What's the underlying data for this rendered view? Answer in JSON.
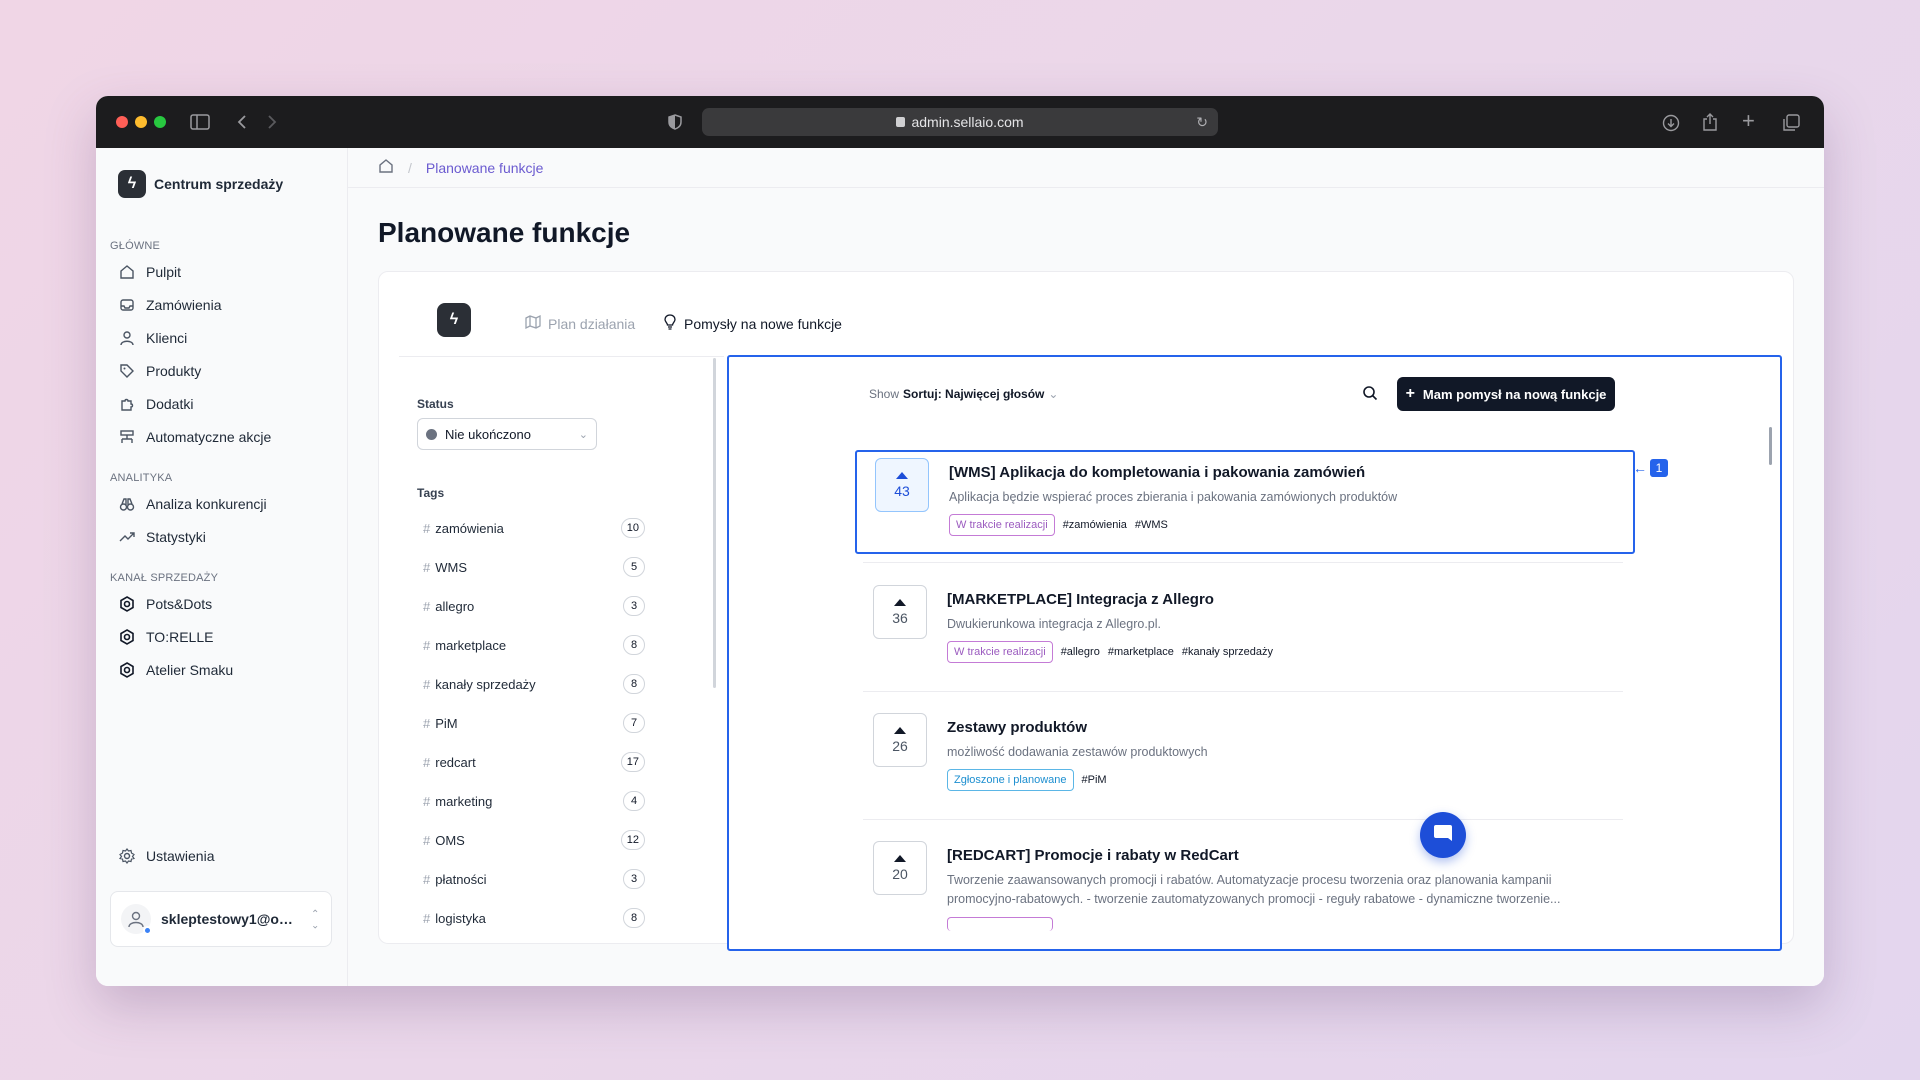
{
  "browser": {
    "url": "admin.sellaio.com",
    "traffic_colors": [
      "#ff5f57",
      "#febc2e",
      "#28c840"
    ]
  },
  "sidebar": {
    "brand": "Centrum sprzedaży",
    "sections": [
      {
        "title": "GŁÓWNE",
        "items": [
          {
            "label": "Pulpit",
            "icon": "home-icon"
          },
          {
            "label": "Zamówienia",
            "icon": "inbox-icon"
          },
          {
            "label": "Klienci",
            "icon": "user-icon"
          },
          {
            "label": "Produkty",
            "icon": "tag-icon"
          },
          {
            "label": "Dodatki",
            "icon": "puzzle-icon"
          },
          {
            "label": "Automatyczne akcje",
            "icon": "workflow-icon"
          }
        ]
      },
      {
        "title": "ANALITYKA",
        "items": [
          {
            "label": "Analiza konkurencji",
            "icon": "binoculars-icon"
          },
          {
            "label": "Statystyki",
            "icon": "trend-icon"
          }
        ]
      },
      {
        "title": "KANAŁ SPRZEDAŻY",
        "items": [
          {
            "label": "Pots&Dots",
            "icon": "store-icon"
          },
          {
            "label": "TO:RELLE",
            "icon": "store-icon"
          },
          {
            "label": "Atelier Smaku",
            "icon": "store-icon"
          }
        ]
      }
    ],
    "settings": "Ustawienia",
    "user_email": "skleptestowy1@onet.pl"
  },
  "breadcrumb": {
    "current": "Planowane funkcje"
  },
  "page_title": "Planowane funkcje",
  "tabs": [
    {
      "label": "Plan działania",
      "icon": "map-icon"
    },
    {
      "label": "Pomysły na nowe funkcje",
      "icon": "lightbulb-icon"
    }
  ],
  "filters": {
    "status_label": "Status",
    "status_value": "Nie ukończono",
    "tags_label": "Tags",
    "tags": [
      {
        "name": "zamówienia",
        "count": "10"
      },
      {
        "name": "WMS",
        "count": "5"
      },
      {
        "name": "allegro",
        "count": "3"
      },
      {
        "name": "marketplace",
        "count": "8"
      },
      {
        "name": "kanały sprzedaży",
        "count": "8"
      },
      {
        "name": "PiM",
        "count": "7"
      },
      {
        "name": "redcart",
        "count": "17"
      },
      {
        "name": "marketing",
        "count": "4"
      },
      {
        "name": "OMS",
        "count": "12"
      },
      {
        "name": "płatności",
        "count": "3"
      },
      {
        "name": "logistyka",
        "count": "8"
      }
    ]
  },
  "toolbar": {
    "show": "Show",
    "sort": "Sortuj: Najwięcej głosów",
    "idea_button": "Mam pomysł na nową funkcje"
  },
  "features": [
    {
      "votes": "43",
      "title": "[WMS] Aplikacja do kompletowania i pakowania zamówień",
      "desc": "Aplikacja będzie wspierać proces zbierania i pakowania zamówionych produktów",
      "status": "W trakcie realizacji",
      "status_kind": "progress",
      "tags": [
        "#zamówienia",
        "#WMS"
      ]
    },
    {
      "votes": "36",
      "title": "[MARKETPLACE] Integracja z Allegro",
      "desc": "Dwukierunkowa integracja z Allegro.pl.",
      "status": "W trakcie realizacji",
      "status_kind": "progress",
      "tags": [
        "#allegro",
        "#marketplace",
        "#kanały sprzedaży"
      ]
    },
    {
      "votes": "26",
      "title": "Zestawy produktów",
      "desc": "możliwość dodawania zestawów produktowych",
      "status": "Zgłoszone i planowane",
      "status_kind": "planned",
      "tags": [
        "#PiM"
      ]
    },
    {
      "votes": "20",
      "title": "[REDCART] Promocje i rabaty w RedCart",
      "desc": "Tworzenie zaawansowanych promocji i rabatów. Automatyzacje procesu tworzenia oraz planowania kampanii promocyjno-rabatowych. - tworzenie zautomatyzowanych promocji - reguły rabatowe - dynamiczne tworzenie...",
      "status": "",
      "status_kind": "progress",
      "tags": []
    }
  ],
  "annotation": {
    "marker": "1"
  }
}
